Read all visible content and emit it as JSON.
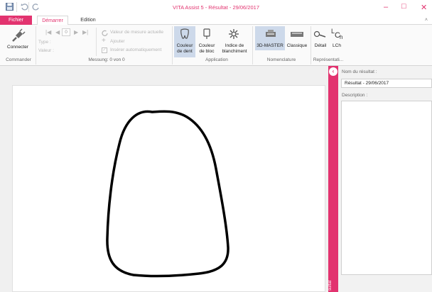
{
  "window": {
    "title": "VITA Assist 5 - Résultat - 29/06/2017",
    "minimize_glyph": "–",
    "maximize_glyph": "□",
    "close_glyph": "✕"
  },
  "ribbon_tabs": {
    "file": "Fichier",
    "start": "Démarrer",
    "edition": "Edition",
    "collapse_glyph": "˄"
  },
  "ribbon": {
    "command": {
      "connect_label": "Connecter",
      "group_label": "Commander"
    },
    "measurement": {
      "counter_value": "0",
      "type_label": "Type :",
      "value_label": "Valeur :",
      "current_value_label": "Valeur de mesure actuelle",
      "add_label": "Ajouter",
      "auto_insert_label": "Insérer automatiquement",
      "group_label": "Messung: 0 von 0"
    },
    "application": {
      "tooth_color_line1": "Couleur",
      "tooth_color_line2": "de dent",
      "block_color_line1": "Couleur",
      "block_color_line2": "de bloc",
      "whitening_line1": "Indice de",
      "whitening_line2": "blanchiment",
      "group_label": "Application"
    },
    "nomenclature": {
      "master_label": "3D-MASTER",
      "classic_label": "Classique",
      "group_label": "Nomenclature"
    },
    "representation": {
      "detail_label": "Détail",
      "lch_label": "LCh",
      "group_label": "Représentati..."
    }
  },
  "side_panel": {
    "strip_text": "sultat",
    "result_name_label": "Nom du résultat :",
    "result_name_value": "Résultat - 29/06/2017",
    "description_label": "Description :"
  },
  "colors": {
    "accent": "#e2336f",
    "ribbon_bg": "#fafafa",
    "highlight": "#cdd9ea",
    "workspace_bg": "#f0f0f0"
  },
  "icons": [
    "save-icon",
    "undo-icon",
    "redo-icon",
    "connect-plug-icon",
    "first-icon",
    "previous-icon",
    "next-icon",
    "last-icon",
    "refresh-icon",
    "add-icon",
    "checkbox-icon",
    "tooth-icon",
    "block-icon",
    "whitening-icon",
    "shade-guide-icon",
    "classic-guide-icon",
    "detail-icon",
    "lch-icon",
    "collapse-panel-icon"
  ]
}
